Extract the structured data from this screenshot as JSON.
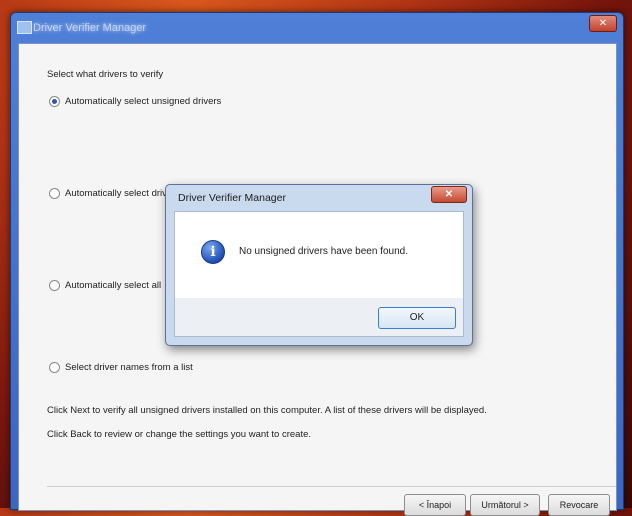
{
  "window": {
    "title": "Driver Verifier Manager",
    "close_label": "✕"
  },
  "main": {
    "heading": "Select what drivers to verify",
    "options": [
      {
        "label": "Automatically select unsigned drivers",
        "selected": true
      },
      {
        "label": "Automatically select drivers built for older versions of Windows",
        "selected": false
      },
      {
        "label": "Automatically select all",
        "selected": false
      },
      {
        "label": "Select driver names from a list",
        "selected": false
      }
    ],
    "info_line_1": "Click Next to verify all unsigned drivers installed on this computer. A list of these drivers will be displayed.",
    "info_line_2": "Click Back to review or change the settings you want to create."
  },
  "buttons": {
    "back": "< Înapoi",
    "next": "Următorul >",
    "cancel": "Revocare"
  },
  "dialog": {
    "title": "Driver Verifier Manager",
    "close_label": "✕",
    "icon": "info-icon",
    "icon_glyph": "i",
    "message": "No unsigned drivers have been found.",
    "ok_label": "OK"
  }
}
